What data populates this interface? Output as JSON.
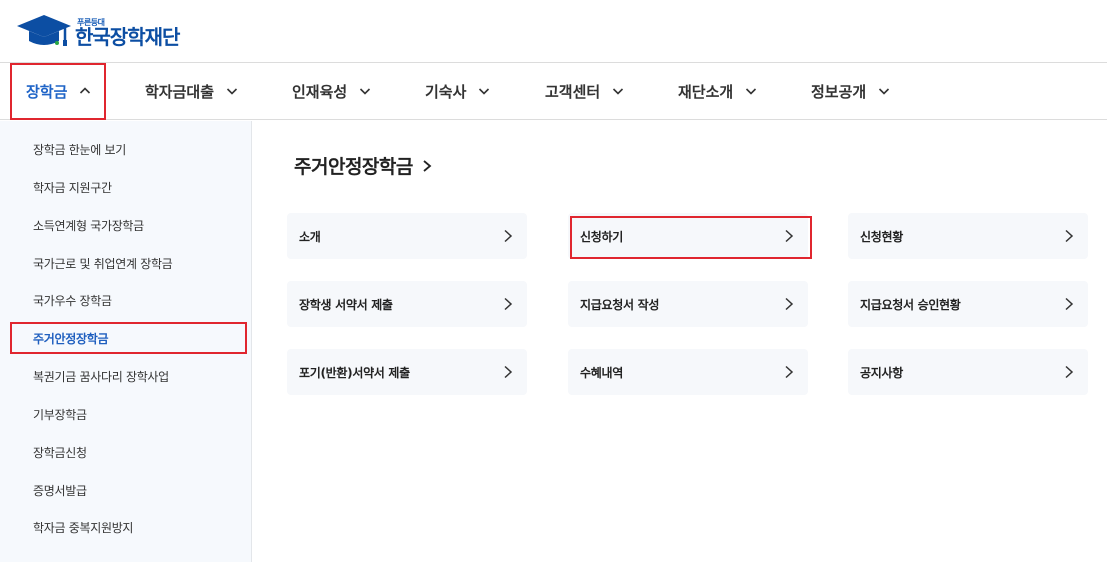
{
  "logo": {
    "sub": "푸른등대",
    "main": "한국장학재단",
    "colors": {
      "primary": "#0c4ea3",
      "accent": "#1b5fb8"
    }
  },
  "gnb": {
    "items": [
      {
        "label": "장학금",
        "icon": "chevron-up-icon",
        "active": true
      },
      {
        "label": "학자금대출",
        "icon": "chevron-down-icon"
      },
      {
        "label": "인재육성",
        "icon": "chevron-down-icon"
      },
      {
        "label": "기숙사",
        "icon": "chevron-down-icon"
      },
      {
        "label": "고객센터",
        "icon": "chevron-down-icon"
      },
      {
        "label": "재단소개",
        "icon": "chevron-down-icon"
      },
      {
        "label": "정보공개",
        "icon": "chevron-down-icon"
      }
    ]
  },
  "sidebar": {
    "items": [
      {
        "label": "장학금 한눈에 보기"
      },
      {
        "label": "학자금 지원구간"
      },
      {
        "label": "소득연계형 국가장학금"
      },
      {
        "label": "국가근로 및 취업연계 장학금"
      },
      {
        "label": "국가우수 장학금"
      },
      {
        "label": "주거안정장학금",
        "active": true
      },
      {
        "label": "복권기금 꿈사다리 장학사업"
      },
      {
        "label": "기부장학금"
      },
      {
        "label": "장학금신청"
      },
      {
        "label": "증명서발급"
      },
      {
        "label": "학자금 중복지원방지"
      }
    ]
  },
  "main": {
    "title": "주거안정장학금",
    "cards": [
      {
        "label": "소개"
      },
      {
        "label": "신청하기",
        "highlighted": true
      },
      {
        "label": "신청현황"
      },
      {
        "label": "장학생 서약서 제출"
      },
      {
        "label": "지급요청서 작성"
      },
      {
        "label": "지급요청서 승인현황"
      },
      {
        "label": "포기(반환)서약서 제출"
      },
      {
        "label": "수혜내역"
      },
      {
        "label": "공지사항"
      }
    ]
  },
  "colors": {
    "highlight": "#e0262f",
    "active": "#1f64c7"
  }
}
